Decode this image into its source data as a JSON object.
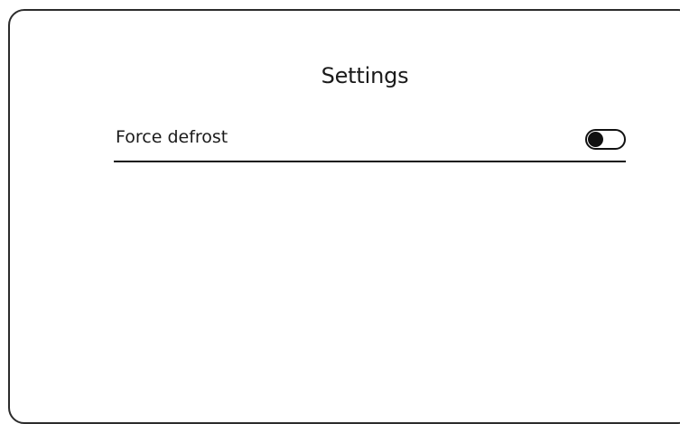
{
  "settings": {
    "title": "Settings",
    "items": [
      {
        "label": "Force defrost",
        "toggle": {
          "on": false
        }
      }
    ]
  },
  "colors": {
    "background": "#ffffff",
    "border": "#2b2b2b",
    "text": "#1a1a1a",
    "divider": "#111111",
    "toggle": "#111111"
  },
  "icons": {
    "toggle": "toggle-switch-icon"
  }
}
